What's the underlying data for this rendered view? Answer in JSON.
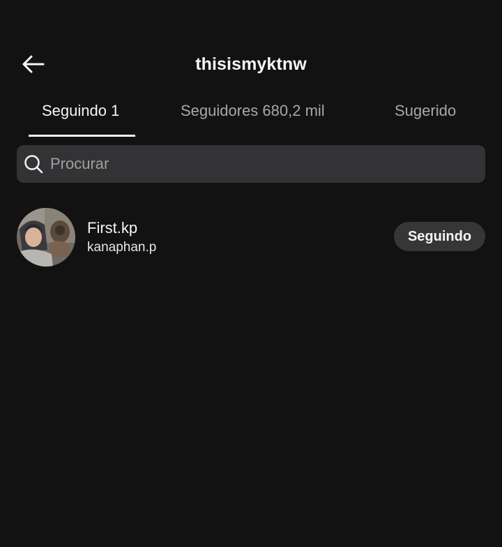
{
  "header": {
    "title": "thisismyktnw",
    "back_icon": "arrow-left-icon"
  },
  "tabs": [
    {
      "label": "Seguindo 1",
      "active": true
    },
    {
      "label": "Seguidores 680,2 mil",
      "active": false
    },
    {
      "label": "Sugerido",
      "active": false
    }
  ],
  "search": {
    "placeholder": "Procurar",
    "value": "",
    "icon": "search-icon"
  },
  "list": [
    {
      "display_name": "First.kp",
      "username": "kanaphan.p",
      "button_label": "Seguindo"
    }
  ],
  "colors": {
    "background": "#121212",
    "text": "#f5f5f5",
    "muted_text": "#a8a8a8",
    "search_bg": "#333335",
    "button_bg": "#363636"
  }
}
